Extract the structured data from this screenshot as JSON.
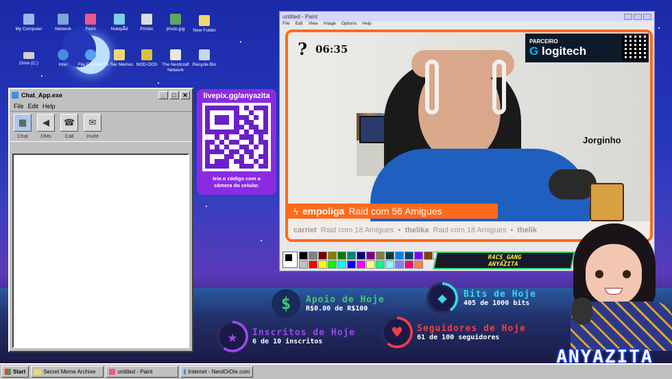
{
  "desktop": {
    "icons_row1": [
      {
        "label": "My Computer",
        "icon": "computer-icon",
        "color": "#9bb8e8"
      },
      {
        "label": "Network",
        "icon": "network-icon",
        "color": "#7ca6d8"
      },
      {
        "label": "Paint",
        "icon": "paint-icon",
        "color": "#e85a8a"
      },
      {
        "label": "Notepad",
        "icon": "notepad-icon",
        "color": "#7ad0e8"
      },
      {
        "label": "Printer",
        "icon": "printer-icon",
        "color": "#dcdcdc"
      },
      {
        "label": "photo.jpg",
        "icon": "image-file-icon",
        "color": "#5aa860"
      },
      {
        "label": "New Folder",
        "icon": "folder-icon",
        "color": "#f0d870"
      }
    ],
    "icons_row2": [
      {
        "label": "Drive (C:)",
        "icon": "drive-icon",
        "color": "#cfcfcf"
      },
      {
        "label": "Inter",
        "icon": "internet-icon",
        "color": "#4a8ae0"
      },
      {
        "label": "File Explorer",
        "icon": "explorer-icon",
        "color": "#58a0e8"
      },
      {
        "label": "S-Tier Memes",
        "icon": "folder-icon",
        "color": "#f0d870"
      },
      {
        "label": "NOD-DOS",
        "icon": "dos-icon",
        "color": "#d8c040"
      },
      {
        "label": "The Nerdcraft Network",
        "icon": "nerdcraft-icon",
        "color": "#e8e8e8"
      },
      {
        "label": "Recycle Bin",
        "icon": "recycle-bin-icon",
        "color": "#c8d8e8"
      }
    ]
  },
  "chat_window": {
    "title": "Chat_App.exe",
    "menu": [
      "File",
      "Edit",
      "Help"
    ],
    "tools": [
      {
        "label": "Chat",
        "icon": "chat-icon"
      },
      {
        "label": "DMs",
        "icon": "megaphone-icon"
      },
      {
        "label": "Call",
        "icon": "call-icon"
      },
      {
        "label": "Invite",
        "icon": "invite-icon"
      }
    ]
  },
  "qr_panel": {
    "url": "livepix.gg/anyazita",
    "caption_line1": "leia o código com a",
    "caption_line2": "câmera do celular."
  },
  "paint_window": {
    "title": "untitled - Paint",
    "menu": [
      "File",
      "Edit",
      "View",
      "Image",
      "Options",
      "Help"
    ]
  },
  "stream": {
    "timer": "06:35",
    "partner_label": "PARCEIRO",
    "partner_brand": "logitech",
    "pet_name": "Jorginho",
    "raid_user": "empoliga",
    "raid_text": "Raid com 56 Amigues",
    "ticker": [
      {
        "user": "carriet",
        "text": "Raid com 18 Amigues"
      },
      {
        "user": "thelika",
        "text": "Raid com 18 Amigues"
      },
      {
        "user": "thelik",
        "text": ""
      }
    ],
    "gang_line1": "R4CS_GANG",
    "gang_line2": "ANYAZITA"
  },
  "stats": {
    "apoio_title": "Apoio de Hoje",
    "apoio_value": "R$0.00 de R$100",
    "bits_title": "Bits de Hoje",
    "bits_value": "405 de 1000 bits",
    "bits_progress": 0.405,
    "inscritos_title": "Inscritos de Hoje",
    "inscritos_value": "6 de 10 inscritos",
    "inscritos_progress": 0.6,
    "seguidores_title": "Seguidores de Hoje",
    "seguidores_value": "61 de 100 seguidores",
    "seguidores_progress": 0.61
  },
  "brand": "ANYAZITA",
  "taskbar": {
    "start": "Start",
    "items": [
      {
        "label": "Secret Meme Archive",
        "icon": "folder-icon"
      },
      {
        "label": "untitled - Paint",
        "icon": "paint-icon"
      },
      {
        "label": "Internet - NerdOrDie.com",
        "icon": "internet-icon"
      }
    ]
  },
  "colors": {
    "accent_orange": "#ff6a1a",
    "qr_purple": "#8a2be2",
    "apoio_green": "#3ad06a",
    "bits_cyan": "#3ad8e8",
    "inscritos_purple": "#9a4ae8",
    "seguidores_red": "#f04040"
  }
}
